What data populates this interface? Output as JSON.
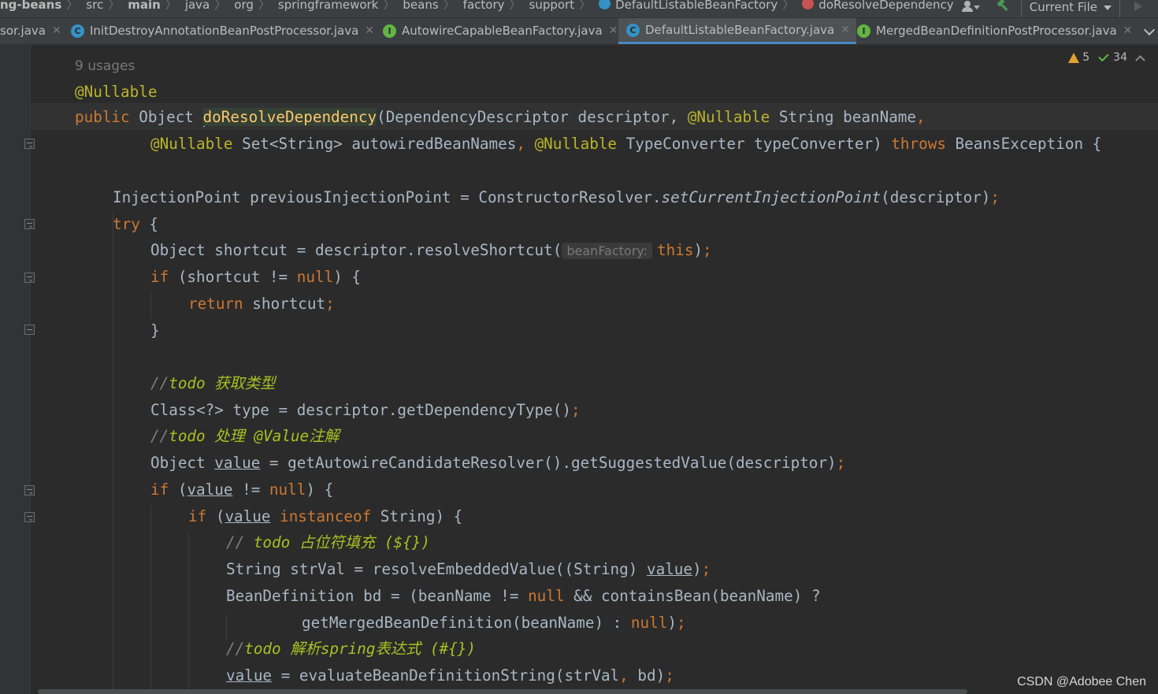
{
  "breadcrumb": {
    "items": [
      "ng-beans",
      "src",
      "main",
      "java",
      "org",
      "springframework",
      "beans",
      "factory",
      "support",
      "DefaultListableBeanFactory",
      "doResolveDependency"
    ]
  },
  "toolbar": {
    "run_config": "Current File",
    "icons": [
      "user-icon",
      "hammer-icon",
      "run-icon"
    ]
  },
  "tabs": [
    {
      "label": "sor.java",
      "icon": "none",
      "active": false
    },
    {
      "label": "InitDestroyAnnotationBeanPostProcessor.java",
      "icon": "class-icon",
      "active": false
    },
    {
      "label": "AutowireCapableBeanFactory.java",
      "icon": "interface-icon",
      "active": false
    },
    {
      "label": "DefaultListableBeanFactory.java",
      "icon": "class-icon",
      "active": true
    },
    {
      "label": "MergedBeanDefinitionPostProcessor.java",
      "icon": "interface-icon",
      "active": false
    }
  ],
  "inspections": {
    "warnings": "5",
    "checks": "34"
  },
  "code": {
    "usages": "9 usages",
    "hint_beanfactory": "beanFactory:",
    "lines": {
      "l1": "@Nullable",
      "l3a": "descriptor, ",
      "comment_todo1": "获取类型",
      "comment_todo2": "处理 @Value注解",
      "comment_todo3": "占位符填充 (${})",
      "comment_todo4": "解析spring表达式 (#{})"
    }
  },
  "watermark": "CSDN @Adobee Chen",
  "colors": {
    "background": "#2b2b2b",
    "keyword": "#cc7832",
    "annotation": "#bbb529",
    "function": "#ffc66d",
    "todo": "#a8c023",
    "active_tab_underline": "#4a88c7"
  }
}
